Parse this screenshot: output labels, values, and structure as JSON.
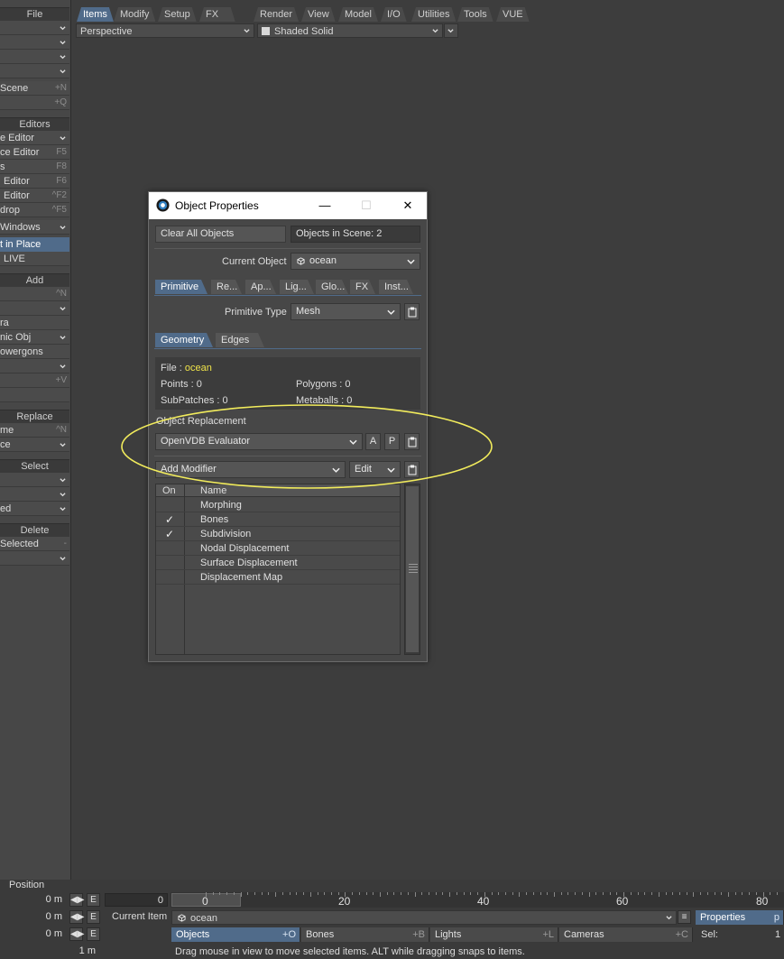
{
  "left_panel": {
    "file": "File",
    "scene": "Scene",
    "scene_key": "+N",
    "q_key": "+Q",
    "editors_header": "Editors",
    "editor1": "e Editor",
    "editor2": "ce Editor",
    "editor2_key": "F5",
    "editor3": "s",
    "editor3_key": "F8",
    "editor4": "Editor",
    "editor4_key": "F6",
    "editor5": "Editor",
    "editor5_key": "^F2",
    "editor6": "drop",
    "editor6_key": "^F5",
    "windows": "Windows",
    "in_place": "t in Place",
    "live": "LIVE",
    "add_header": "Add",
    "add_key": "^N",
    "add_item1": "ra",
    "add_item2": "nic Obj",
    "add_item3": "owergons",
    "add_v_key": "+V",
    "replace_header": "Replace",
    "replace_item1": "me",
    "replace_key": "^N",
    "replace_item2": "ce",
    "select_header": "Select",
    "select_item": "ed",
    "delete_header": "Delete",
    "delete_selected": "Selected",
    "delete_key": "-"
  },
  "menu_tabs": [
    "Items",
    "Modify",
    "Setup",
    "FX Tools",
    "Render",
    "View",
    "Model",
    "I/O",
    "Utilities",
    "Tools",
    "VUE"
  ],
  "viewport": {
    "view_mode": "Perspective",
    "shading": "Shaded Solid"
  },
  "dialog": {
    "title": "Object Properties",
    "clear_all": "Clear All Objects",
    "objects_in_scene": "Objects in Scene: 2",
    "current_object_label": "Current Object",
    "current_object": "ocean",
    "tabs": [
      "Primitive",
      "Re...",
      "Ap...",
      "Lig...",
      "Glo...",
      "FX",
      "Inst..."
    ],
    "primitive_type_label": "Primitive Type",
    "primitive_type": "Mesh",
    "sub_tabs": [
      "Geometry",
      "Edges"
    ],
    "file_label": "File :",
    "file_value": "ocean",
    "points": "Points : 0",
    "polygons": "Polygons : 0",
    "subpatches": "SubPatches : 0",
    "metaballs": "Metaballs : 0",
    "object_replacement_label": "Object Replacement",
    "replacement": "OpenVDB Evaluator",
    "btn_a": "A",
    "btn_p": "P",
    "add_modifier": "Add Modifier",
    "edit": "Edit",
    "col_on": "On",
    "col_name": "Name",
    "modifiers": [
      {
        "name": "Morphing",
        "on": ""
      },
      {
        "name": "Bones",
        "on": "✓"
      },
      {
        "name": "Subdivision",
        "on": "✓"
      },
      {
        "name": "Nodal Displacement",
        "on": ""
      },
      {
        "name": "Surface Displacement",
        "on": ""
      },
      {
        "name": "Displacement Map",
        "on": ""
      }
    ],
    "annotation_color": "#f2ec5c"
  },
  "timeline": {
    "position_label": "Position",
    "pos_x": "0 m",
    "pos_y": "0 m",
    "pos_z": "0 m",
    "grid": "1 m",
    "frame_value": "0",
    "ticks": [
      "0",
      "20",
      "40",
      "60",
      "80"
    ],
    "current_item_label": "Current Item",
    "current_item": "ocean",
    "properties": "Properties",
    "properties_key": "p",
    "sel_label": "Sel:",
    "sel_value": "1",
    "objects": "Objects",
    "objects_key": "+O",
    "bones": "Bones",
    "bones_key": "+B",
    "lights": "Lights",
    "lights_key": "+L",
    "cameras": "Cameras",
    "cameras_key": "+C",
    "status": "Drag mouse in view to move selected items. ALT while dragging snaps to items."
  }
}
